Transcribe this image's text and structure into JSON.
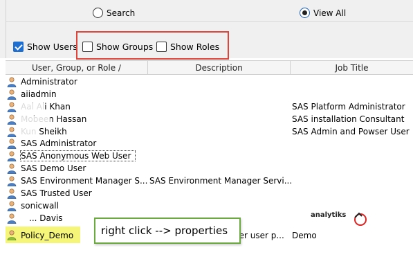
{
  "search_mode": {
    "search_label": "Search",
    "view_all_label": "View All",
    "selected": "View All"
  },
  "filters": {
    "show_users": {
      "label": "Show Users",
      "checked": true
    },
    "show_groups": {
      "label": "Show Groups",
      "checked": false
    },
    "show_roles": {
      "label": "Show Roles",
      "checked": false
    }
  },
  "table": {
    "columns": [
      "User, Group, or Role ∕",
      "Description",
      "Job Title"
    ],
    "rows": [
      {
        "name": "Administrator",
        "description": "",
        "job_title": ""
      },
      {
        "name": "aiiadmin",
        "description": "",
        "job_title": ""
      },
      {
        "name": "Aal Ali Khan",
        "description": "",
        "job_title": "SAS Platform Administrator"
      },
      {
        "name": "Mobeen Hassan",
        "description": "",
        "job_title": "SAS installation Consultant"
      },
      {
        "name": "Kun Sheikh",
        "description": "",
        "job_title": "SAS Admin and Powser User"
      },
      {
        "name": "SAS Administrator",
        "description": "",
        "job_title": ""
      },
      {
        "name": "SAS Anonymous Web User",
        "description": "",
        "job_title": ""
      },
      {
        "name": "SAS Demo User",
        "description": "",
        "job_title": ""
      },
      {
        "name": "SAS Environment Manager S...",
        "description": "SAS Environment Manager Servi...",
        "job_title": ""
      },
      {
        "name": "SAS Trusted User",
        "description": "",
        "job_title": ""
      },
      {
        "name": "sonicwall",
        "description": "",
        "job_title": ""
      },
      {
        "name": "... Davis",
        "description": "",
        "job_title": ""
      },
      {
        "name": "Policy_Demo",
        "description": "per user p...",
        "job_title": "Demo"
      }
    ]
  },
  "annotation": {
    "callout_text": "right click --> properties",
    "logo_text": "analytiks"
  },
  "colors": {
    "highlight_border": "#e0433a",
    "callout_border": "#6aaa3e",
    "selected_bg": "#f5f57a",
    "checkbox_accent": "#1f6fd1"
  }
}
